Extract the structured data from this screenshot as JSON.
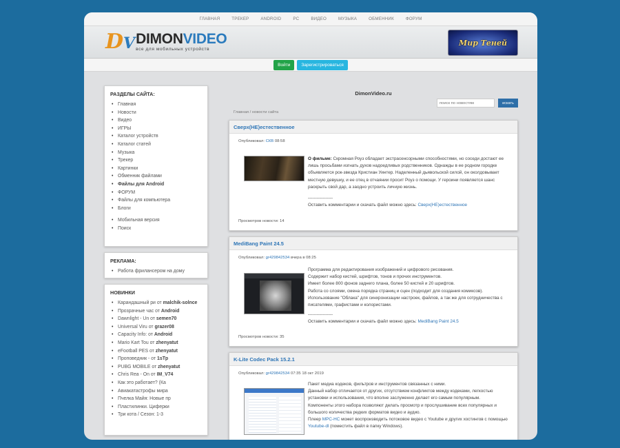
{
  "nav": [
    "ГЛАВНАЯ",
    "ТРЕКЕР",
    "ANDROID",
    "PC",
    "ВИДЕО",
    "МУЗЫКА",
    "ОБМЕННИК",
    "ФОРУМ"
  ],
  "logo": {
    "tagline": "все для мобильных устройств"
  },
  "banner": {
    "text": "Мир Теней"
  },
  "auth": {
    "login": "Войти",
    "register": "Зарегистрироваться"
  },
  "sections": {
    "title": "РАЗДЕЛЫ САЙТА:",
    "items": [
      "Главная",
      "Новости",
      "Видео",
      "ИГРЫ",
      "Каталог устройств",
      "Каталог статей",
      "Музыка",
      "Трекер",
      "Картинки",
      "Обменник файлами",
      "Файлы для Android",
      "ФОРУМ",
      "Файлы для компьютера",
      "Блоги"
    ],
    "extra": [
      "Мобильная версия",
      "Поиск"
    ]
  },
  "ads": {
    "title": "РЕКЛАМА:",
    "items": [
      "Работа фрилансером на дому"
    ]
  },
  "latest": {
    "title": "НОВИНКИ",
    "items": [
      {
        "name": "Карандашный ри",
        "by": "от",
        "user": "malchik-solnce"
      },
      {
        "name": "Прозрачные час",
        "by": "от",
        "user": "Android"
      },
      {
        "name": "Dawnlight - Un",
        "by": "от",
        "user": "semen70"
      },
      {
        "name": "Universal Viru",
        "by": "от",
        "user": "grazer08"
      },
      {
        "name": "Capacity Info:",
        "by": "от",
        "user": "Android"
      },
      {
        "name": "Mario Kart Tou",
        "by": "от",
        "user": "zhenyatut"
      },
      {
        "name": "eFootball PES",
        "by": "от",
        "user": "zhenyatut"
      },
      {
        "name": "Проповедник -",
        "by": "от",
        "user": "1sTp"
      },
      {
        "name": "PUBG MOBILE",
        "by": "от",
        "user": "zhenyatut"
      },
      {
        "name": "Chris Rea - On",
        "by": "от",
        "user": "IM_V74"
      },
      {
        "name": "Как это работает? (Ка",
        "by": "",
        "user": ""
      },
      {
        "name": "Авиакатастрофы мира",
        "by": "",
        "user": ""
      },
      {
        "name": "Пчелка Майя: Новые пр",
        "by": "",
        "user": ""
      },
      {
        "name": "Пластилинки. Циферки",
        "by": "",
        "user": ""
      },
      {
        "name": "Три кота / Сезон: 1-3",
        "by": "",
        "user": ""
      }
    ]
  },
  "main": {
    "site_title": "DimonVideo.ru",
    "search_placeholder": "поиск по новостям",
    "search_button": "искать",
    "breadcrumb": "Главная   /   новости сайта"
  },
  "news": [
    {
      "title": "Сверх(НЕ)естественное",
      "author_label": "Опубликовал:",
      "author": "СКВ",
      "time": "08:58",
      "film_label": "О фильме:",
      "text": "Скромная Роуз обладает экстрасенсорными способностями, но соседи достают ее лишь просьбами изгнать духов надоедливых родственников. Однажды в ее родном городке объявляется рок-звезда Кристиан Уинтер. Наделенный дьявольской силой, он околдовывает местную девушку, и ее отец в отчаянии просит Роуз о помощи. У героини появляется шанс раскрыть свой дар, а заодно устроить личную жизнь.",
      "sep": "-----------------",
      "link_prefix": "Оставить комментарии и скачать файл можно здесь:",
      "link": "Сверх(НЕ)естественное",
      "views": "Просмотров новости: 14"
    },
    {
      "title": "MediBang Paint 24.5",
      "author_label": "Опубликовал:",
      "author": "gr429842534",
      "time": "вчера в 08:25",
      "lines": [
        "Программа для редактирования изображений и цифрового рисования.",
        "Содержит набор кистей, шрифтов, тонов и прочих инструментов.",
        "Имеет более 800 фонов заднего плана, более 50 кистей и 20 шрифтов.",
        "Работа со слоями, смена порядка страниц и сцен (подходит для создания комиксов).",
        "Использование \"Облака\" для синхронизации настроек, файлов, а так же для сотрудничества с писателями, графистами и колористами."
      ],
      "sep": "-----------------",
      "link_prefix": "Оставить комментарии и скачать файл можно здесь:",
      "link": "MediBang Paint 24.5",
      "views": "Просмотров новости: 35"
    },
    {
      "title": "K-Lite Codec Pack 15.2.1",
      "author_label": "Опубликовал:",
      "author": "gr429842534",
      "time": "07:35 18 окт 2019",
      "lines": [
        "Пакет медиа кодеков, фильтров и инструментов связанных с ними.",
        "Данный набор отличается от других, отсутствием конфликтов между кодеками, легкостью установки и использования, что вполне заслуженно делает его самым популярным.",
        "Компоненты этого набора позволяют делать просмотр и прослушивание всех популярных и большого количества редких форматов видео и аудио."
      ],
      "player_prefix": "Плеер",
      "player_link": "MPC-HC",
      "player_mid": "может воспроизводить потоковое видео с Youtube и других хостингов с помощью",
      "player_link2": "Youtube-dl",
      "player_suffix": "(поместить файл в папку Windows)."
    }
  ],
  "colors": {
    "background": "#1c6c9e",
    "link": "#2e75b6",
    "login": "#22a348",
    "register": "#28b6e0"
  }
}
